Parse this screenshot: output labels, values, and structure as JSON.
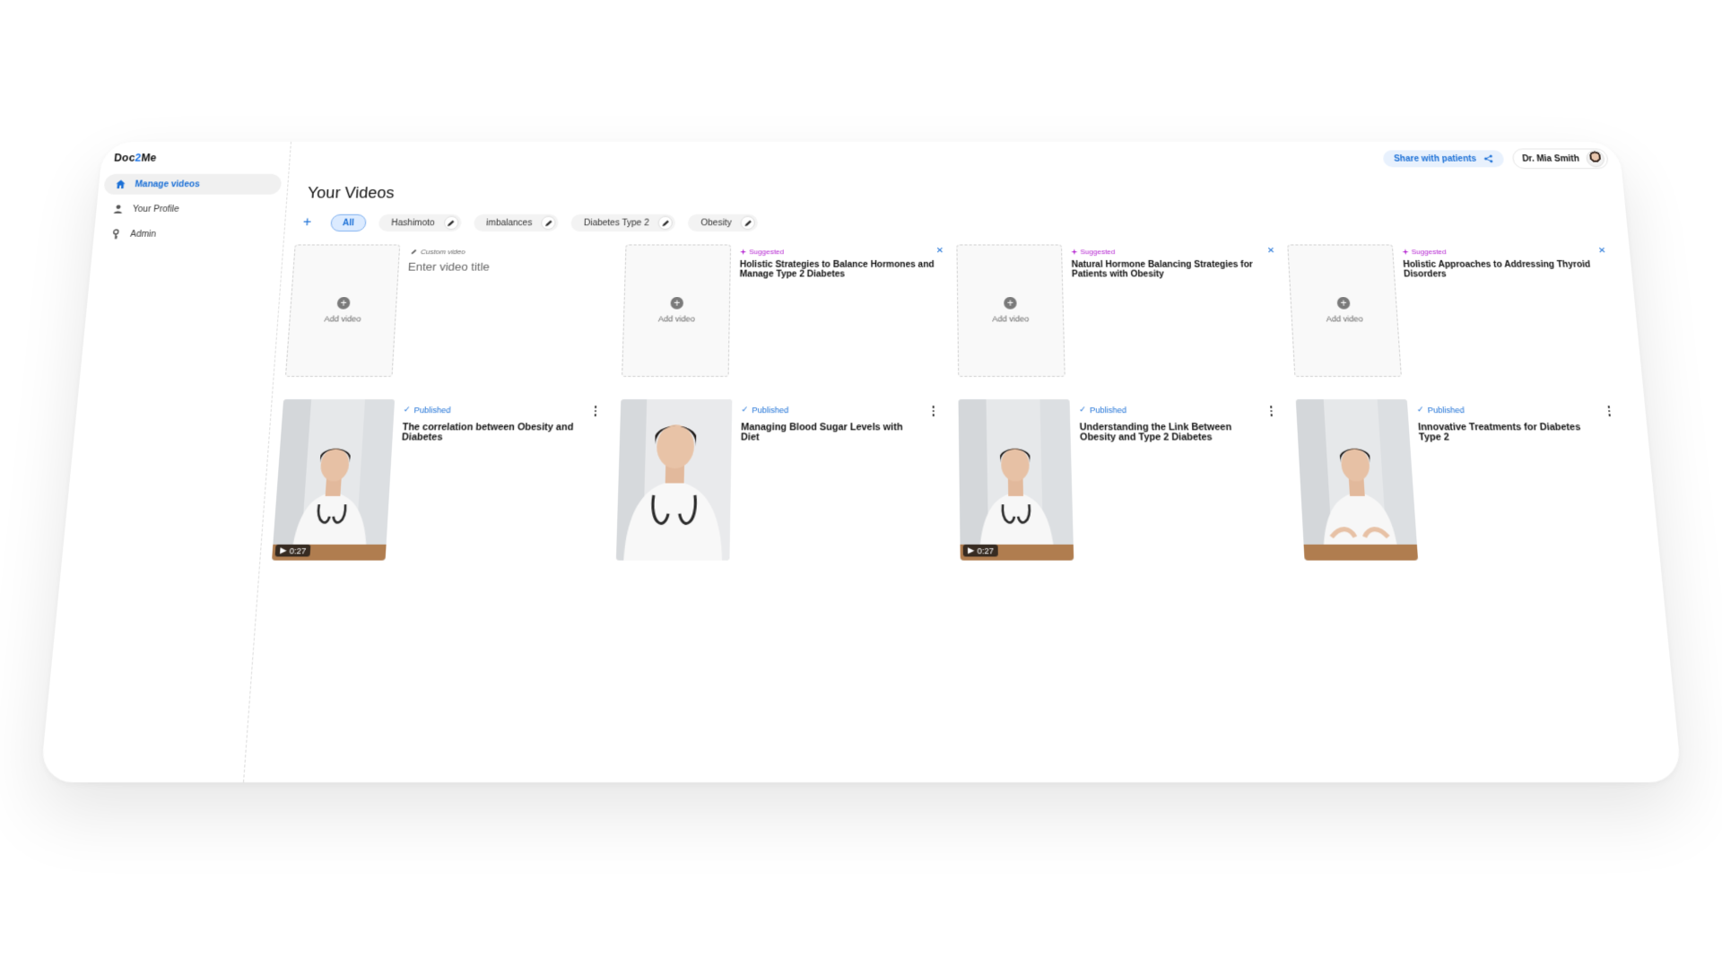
{
  "app": {
    "logo_prefix": "Doc",
    "logo_mid": "2",
    "logo_suffix": "Me"
  },
  "sidebar": {
    "items": [
      {
        "label": "Manage videos",
        "icon": "home-icon",
        "active": true
      },
      {
        "label": "Your Profile",
        "icon": "person-icon",
        "active": false
      },
      {
        "label": "Admin",
        "icon": "key-icon",
        "active": false
      }
    ]
  },
  "header": {
    "share_label": "Share with patients",
    "user_name": "Dr. Mia Smith"
  },
  "main": {
    "title": "Your Videos",
    "filters": [
      {
        "label": "All",
        "active": true,
        "editable": false
      },
      {
        "label": "Hashimoto",
        "active": false,
        "editable": true
      },
      {
        "label": "imbalances",
        "active": false,
        "editable": true
      },
      {
        "label": "Diabetes Type 2",
        "active": false,
        "editable": true
      },
      {
        "label": "Obesity",
        "active": false,
        "editable": true
      }
    ],
    "drafts": [
      {
        "kind": "custom",
        "tag": "Custom video",
        "placeholder": "Enter video title",
        "add_label": "Add video"
      },
      {
        "kind": "suggested",
        "tag": "Suggested",
        "title": "Holistic Strategies to Balance Hormones and Manage Type 2 Diabetes",
        "add_label": "Add video"
      },
      {
        "kind": "suggested",
        "tag": "Suggested",
        "title": "Natural Hormone Balancing Strategies for Patients with Obesity",
        "add_label": "Add video"
      },
      {
        "kind": "suggested",
        "tag": "Suggested",
        "title": "Holistic Approaches to Addressing Thyroid Disorders",
        "add_label": "Add video"
      }
    ],
    "videos": [
      {
        "status": "Published",
        "title": "The correlation between Obesity and Diabetes",
        "duration": "0:27"
      },
      {
        "status": "Published",
        "title": "Managing Blood Sugar Levels with Diet",
        "duration": ""
      },
      {
        "status": "Published",
        "title": "Understanding the Link Between Obesity and Type 2 Diabetes",
        "duration": "0:27"
      },
      {
        "status": "Published",
        "title": "Innovative Treatments for Diabetes Type 2",
        "duration": ""
      }
    ]
  },
  "colors": {
    "accent": "#1a6fd6",
    "suggested": "#b321d0"
  }
}
